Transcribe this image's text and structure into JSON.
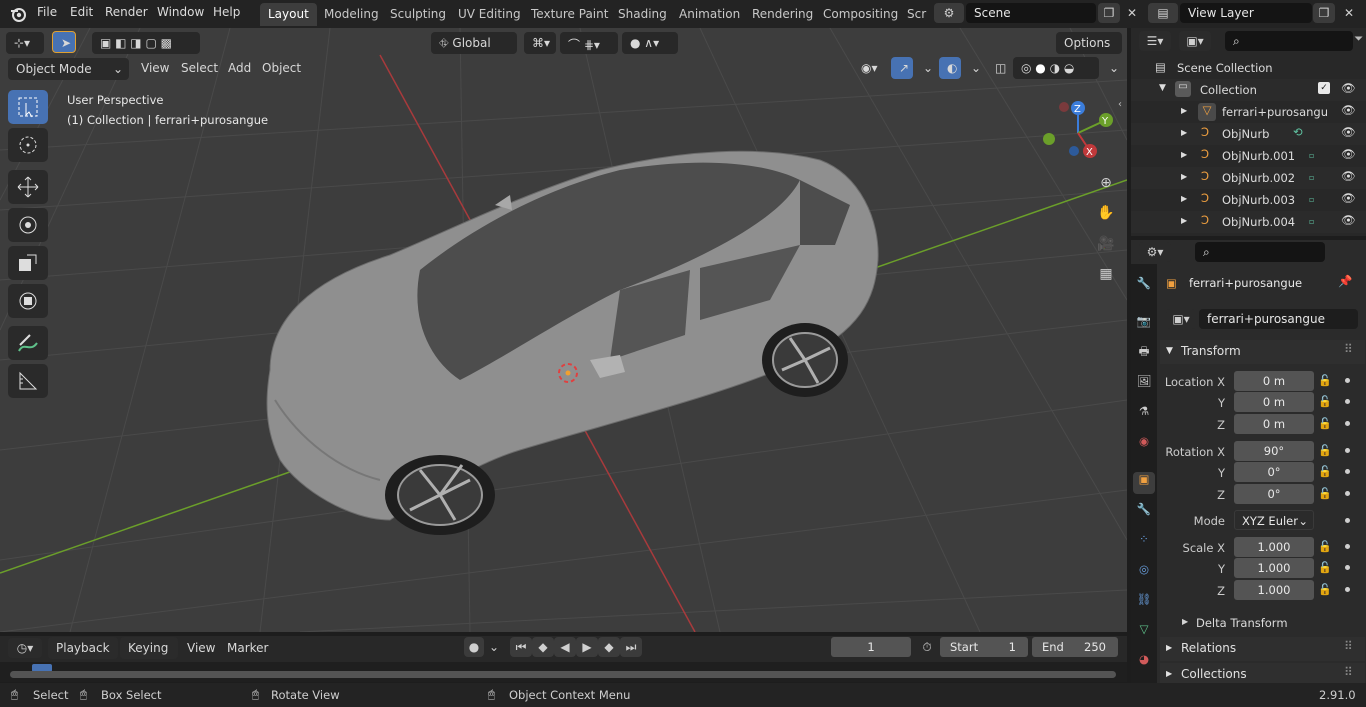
{
  "topbar": {
    "menus": [
      "File",
      "Edit",
      "Render",
      "Window",
      "Help"
    ],
    "workspaces": [
      "Layout",
      "Modeling",
      "Sculpting",
      "UV Editing",
      "Texture Paint",
      "Shading",
      "Animation",
      "Rendering",
      "Compositing",
      "Scr"
    ],
    "active_workspace": "Layout",
    "scene_name": "Scene",
    "view_layer": "View Layer"
  },
  "viewport": {
    "orientation": "Global",
    "options_label": "Options",
    "mode": "Object Mode",
    "menus": [
      "View",
      "Select",
      "Add",
      "Object"
    ],
    "overlay_title": "User Perspective",
    "overlay_subtitle": "(1) Collection | ferrari+purosangue",
    "gizmo": {
      "z": "Z",
      "y": "Y",
      "x": "X"
    }
  },
  "outliner": {
    "root": "Scene Collection",
    "collection": "Collection",
    "items": [
      {
        "name": "ferrari+purosangu",
        "icon": "mesh-icon"
      },
      {
        "name": "ObjNurb",
        "icon": "curve-icon"
      },
      {
        "name": "ObjNurb.001",
        "icon": "curve-icon"
      },
      {
        "name": "ObjNurb.002",
        "icon": "curve-icon"
      },
      {
        "name": "ObjNurb.003",
        "icon": "curve-icon"
      },
      {
        "name": "ObjNurb.004",
        "icon": "curve-icon"
      }
    ]
  },
  "properties": {
    "object_name": "ferrari+purosangue",
    "object_field": "ferrari+purosangue",
    "transform_label": "Transform",
    "location": {
      "label": "Location X",
      "x": "0 m",
      "y": "0 m",
      "z": "0 m"
    },
    "rotation": {
      "label": "Rotation X",
      "x": "90°",
      "y": "0°",
      "z": "0°"
    },
    "mode_label": "Mode",
    "mode_value": "XYZ Euler",
    "scale": {
      "label": "Scale X",
      "x": "1.000",
      "y": "1.000",
      "z": "1.000"
    },
    "axis_y": "Y",
    "axis_z": "Z",
    "delta_transform": "Delta Transform",
    "relations": "Relations",
    "collections": "Collections"
  },
  "timeline": {
    "menus": [
      "Playback",
      "Keying",
      "View",
      "Marker"
    ],
    "current_frame": "1",
    "start_label": "Start",
    "start_value": "1",
    "end_label": "End",
    "end_value": "250"
  },
  "statusbar": {
    "select": "Select",
    "box_select": "Box Select",
    "rotate_view": "Rotate View",
    "context_menu": "Object Context Menu",
    "version": "2.91.0"
  },
  "colors": {
    "accent": "#4772b3",
    "x_axis": "#c0393b",
    "y_axis": "#6b9f2a",
    "z_axis": "#3b7ddb"
  }
}
